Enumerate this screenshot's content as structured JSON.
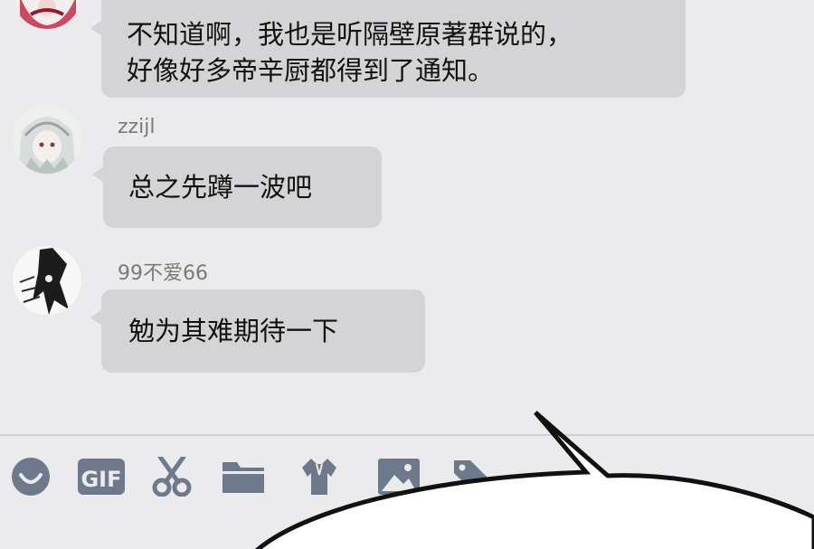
{
  "messages": [
    {
      "sender": "",
      "lines": [
        "不知道啊，我也是听隔壁原著群说的，",
        "好像好多帝辛厨都得到了通知。"
      ]
    },
    {
      "sender": "zzijl",
      "lines": [
        "总之先蹲一波吧"
      ]
    },
    {
      "sender": "99不爱66",
      "lines": [
        "勉为其难期待一下"
      ]
    }
  ],
  "toolbar": {
    "gif_label": "GIF",
    "icons": [
      "emoji-icon",
      "gif-icon",
      "scissors-icon",
      "folder-icon",
      "shirt-icon",
      "image-icon",
      "tag-icon"
    ]
  },
  "colors": {
    "background": "#ebebed",
    "bubble": "#d4d4d6",
    "icon": "#6e7a8c"
  }
}
